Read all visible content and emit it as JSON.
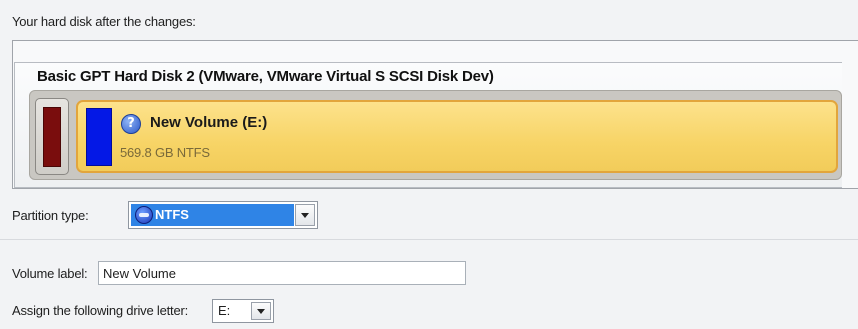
{
  "caption": "Your hard disk after the changes:",
  "disk": {
    "title": "Basic GPT Hard Disk 2 (VMware, VMware Virtual S SCSI Disk Dev)",
    "volume": {
      "name": "New Volume (E:)",
      "size_fs": "569.8 GB NTFS",
      "help_glyph": "?"
    }
  },
  "partition_type": {
    "label": "Partition type:",
    "selected": "NTFS",
    "icon": "ntfs-filesystem-icon"
  },
  "volume_label": {
    "label": "Volume label:",
    "value": "New Volume"
  },
  "drive_letter": {
    "label": "Assign the following drive letter:",
    "selected": "E:"
  },
  "colors": {
    "volume_bar": "#0418e6",
    "unallocated_bar": "#7a0d0d",
    "volume_tile": "#f7d466",
    "selection": "#2f84e6"
  }
}
